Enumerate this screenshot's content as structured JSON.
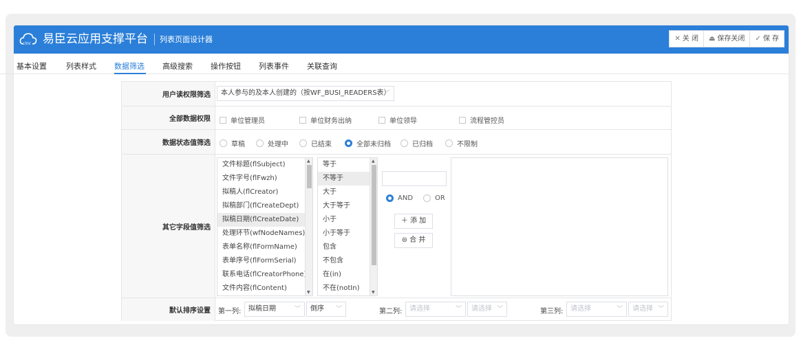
{
  "header": {
    "brand": "易臣云应用支撑平台",
    "subtitle": "列表页面设计器",
    "buttons": {
      "close": "关 闭",
      "save_close": "保存关闭",
      "save": "保 存"
    }
  },
  "tabs": [
    "基本设置",
    "列表样式",
    "数据筛选",
    "高级搜索",
    "操作按钮",
    "列表事件",
    "关联查询"
  ],
  "active_tab": "数据筛选",
  "form": {
    "reader_filter": {
      "label": "用户读权限筛选",
      "value": "本人参与的及本人创建的（按WF_BUSI_READERS表）"
    },
    "all_data": {
      "label": "全部数据权限",
      "options": [
        "单位管理员",
        "单位财务出纳",
        "单位领导",
        "流程管控员"
      ]
    },
    "status_filter": {
      "label": "数据状态值筛选",
      "options": [
        "草稿",
        "处理中",
        "已结束",
        "全部未归档",
        "已归档",
        "不限制"
      ],
      "selected": "全部未归档"
    },
    "other_fields": {
      "label": "其它字段值筛选",
      "fields": [
        "文件标题(flSubject)",
        "文件字号(flFwzh)",
        "拟稿人(flCreator)",
        "拟稿部门(flCreateDept)",
        "拟稿日期(flCreateDate)",
        "处理环节(wfNodeNames)",
        "表单名称(flFormName)",
        "表单序号(flFormSerial)",
        "联系电话(flCreatorPhone)",
        "文件内容(flContent)"
      ],
      "selected_field": "拟稿日期(flCreateDate)",
      "operators": [
        "等于",
        "不等于",
        "大于",
        "大于等于",
        "小于",
        "小于等于",
        "包含",
        "不包含",
        "在(in)",
        "不在(notIn)"
      ],
      "selected_operator": "不等于",
      "logic": {
        "and": "AND",
        "or": "OR",
        "selected": "AND"
      },
      "add_button": "添 加",
      "merge_button": "合 并"
    },
    "sort": {
      "label": "默认排序设置",
      "col1_label": "第一列:",
      "col1_value": "拟稿日期",
      "col1_order": "倒序",
      "col2_label": "第二列:",
      "col2_placeholder": "请选择",
      "col2_order_placeholder": "请选择",
      "col3_label": "第三列:",
      "col3_placeholder": "请选择",
      "col3_order_placeholder": "请选择"
    }
  },
  "colors": {
    "accent": "#2b7fd9",
    "label_bg": "#f7f7f7",
    "outer_bg": "#efeff0"
  }
}
